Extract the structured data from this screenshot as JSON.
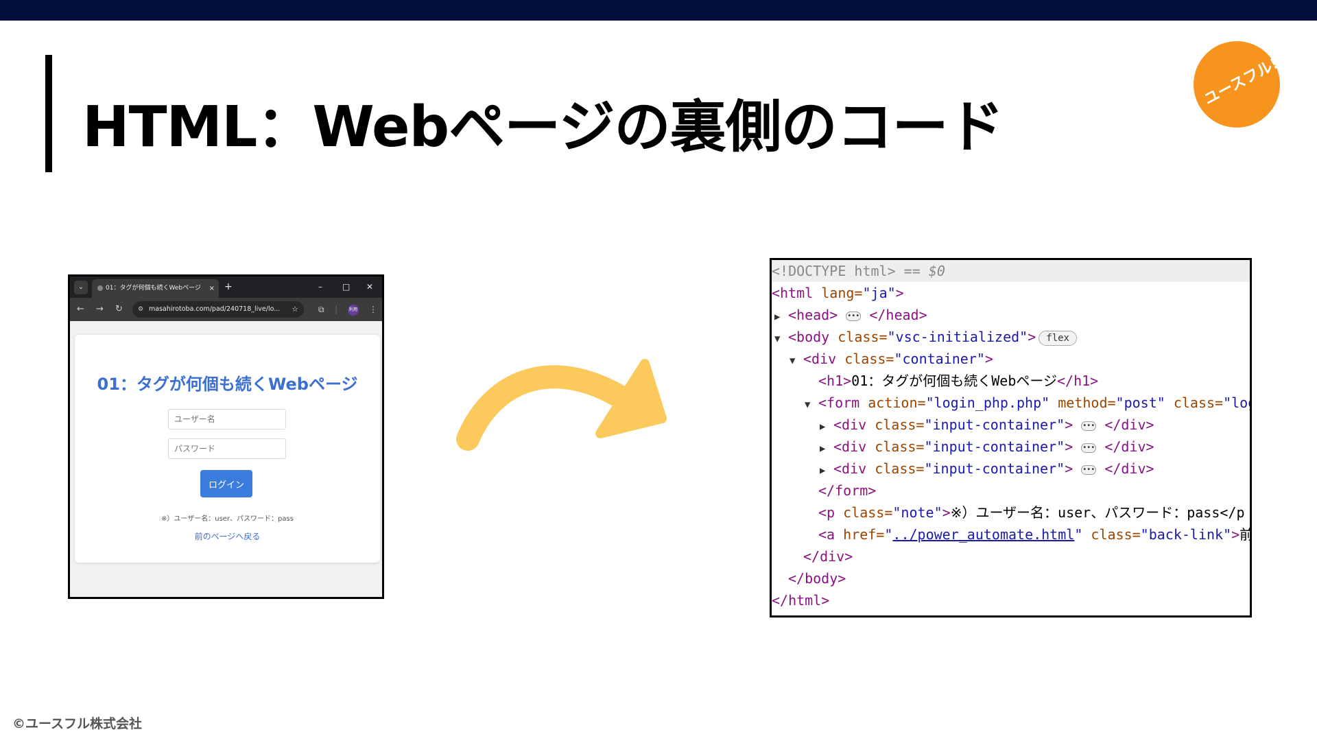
{
  "slide": {
    "title": "HTML：Webページの裏側のコード",
    "logo_text": "ユースフル!",
    "copyright": "©ユースフル株式会社"
  },
  "browser": {
    "tab_title": "01：タグが何個も続くWebページ",
    "tab_close": "×",
    "new_tab": "+",
    "url": "masahirotoba.com/pad/240718_live/lo...",
    "profile_label": "利用",
    "page": {
      "heading": "01：タグが何個も続くWebページ",
      "username_placeholder": "ユーザー名",
      "password_placeholder": "パスワード",
      "login_button": "ログイン",
      "note": "※）ユーザー名：user、パスワード：pass",
      "back_link": "前のページへ戻る"
    }
  },
  "code": {
    "line1": "<!DOCTYPE html>",
    "line1_suffix": "== $0",
    "html_open": "<html",
    "html_attr": "lang=",
    "html_val": "\"ja\"",
    "head": "<head>",
    "head_close": "</head>",
    "body_open": "<body",
    "body_attr": "class=",
    "body_val": "\"vsc-initialized\"",
    "flex_badge": "flex",
    "div_open": "<div",
    "div_attr": "class=",
    "div_val": "\"container\"",
    "h1_open": "<h1>",
    "h1_text": "01：タグが何個も続くWebページ",
    "h1_close": "</h1>",
    "form_open": "<form",
    "form_attr1": "action=",
    "form_val1": "\"login_php.php\"",
    "form_attr2": "method=",
    "form_val2": "\"post\"",
    "form_attr3": "class=",
    "form_val3": "\"login-",
    "input_div_attr": "class=",
    "input_div_val": "\"input-container\"",
    "div_close": "</div>",
    "form_close": "</form>",
    "p_open": "<p",
    "p_attr": "class=",
    "p_val": "\"note\"",
    "p_text": "※）ユーザー名：user、パスワード：pass</p",
    "a_open": "<a",
    "a_attr1": "href=",
    "a_val1": "../power_automate.html",
    "a_attr2": "class=",
    "a_val2": "\"back-link\"",
    "a_text": "前のペ",
    "container_close": "</div>",
    "body_close": "</body>",
    "html_close": "</html>"
  },
  "colors": {
    "topbar": "#020f3a",
    "logo": "#f7941d",
    "arrow": "#fcc95c",
    "heading_blue": "#3b6fd1",
    "button_blue": "#3b7ddd"
  }
}
